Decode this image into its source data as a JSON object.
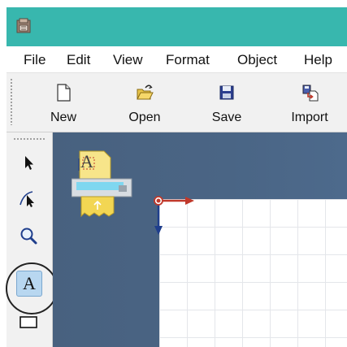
{
  "window": {
    "app_icon": "app-icon",
    "accent_color": "#38b7ae"
  },
  "menu": {
    "items": [
      "File",
      "Edit",
      "View",
      "Format",
      "Object",
      "Help"
    ]
  },
  "toolbar": {
    "buttons": [
      {
        "label": "New",
        "icon": "new-document-icon"
      },
      {
        "label": "Open",
        "icon": "open-folder-icon"
      },
      {
        "label": "Save",
        "icon": "save-disk-icon"
      },
      {
        "label": "Import",
        "icon": "import-icon"
      }
    ]
  },
  "toolbox": {
    "tools": [
      {
        "name": "select-tool",
        "icon": "arrow-pointer-icon"
      },
      {
        "name": "node-edit-tool",
        "icon": "node-pointer-icon"
      },
      {
        "name": "zoom-tool",
        "icon": "magnifier-icon"
      },
      {
        "name": "text-tool",
        "icon": "text-icon",
        "glyph": "A",
        "selected": true
      },
      {
        "name": "rectangle-tool",
        "icon": "rectangle-icon"
      }
    ]
  },
  "canvas": {
    "background_color": "#4a6585",
    "page_color": "#ffffff",
    "printer_icon": "printer-text-icon",
    "printer_glyph": "A",
    "origin_marker": "origin-axes-icon"
  }
}
